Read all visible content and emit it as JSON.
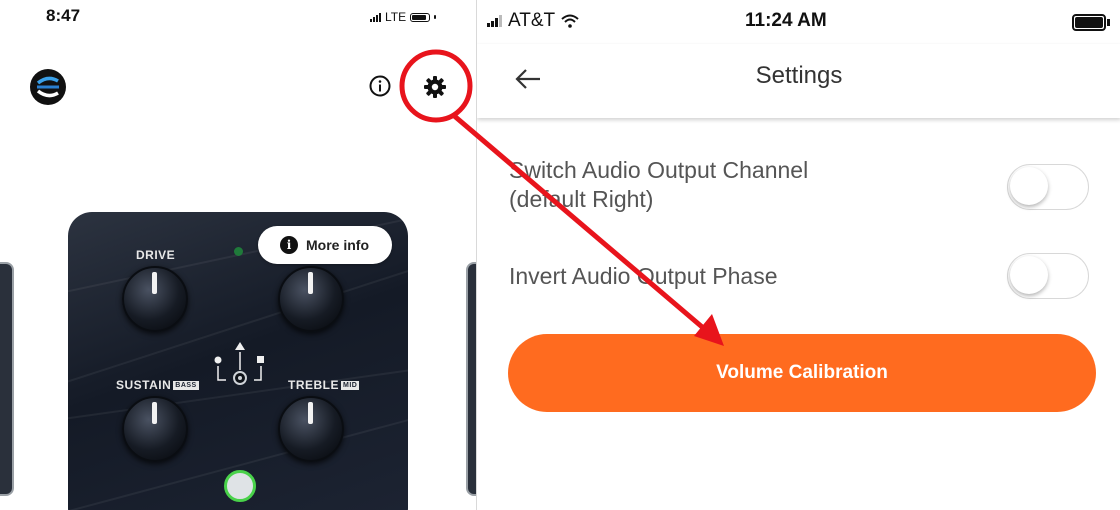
{
  "left_phone": {
    "status": {
      "time": "8:47",
      "network": "LTE"
    },
    "header": {
      "logo_icon": "source-audio-logo-icon",
      "info_icon": "info-circle-icon",
      "settings_icon": "gear-icon"
    },
    "pedal": {
      "knobs": [
        {
          "label": "DRIVE",
          "tag": ""
        },
        {
          "label": "",
          "tag": ""
        },
        {
          "label": "SUSTAIN",
          "tag": "BASS"
        },
        {
          "label": "TREBLE",
          "tag": "MID"
        }
      ]
    },
    "more_info": {
      "label": "More info"
    }
  },
  "right_phone": {
    "status": {
      "carrier": "AT&T",
      "time": "11:24 AM"
    },
    "header": {
      "title": "Settings",
      "back_icon": "arrow-left-icon"
    },
    "settings": [
      {
        "label_line1": "Switch Audio Output Channel",
        "label_line2": "(default Right)",
        "enabled": false
      },
      {
        "label_line1": "Invert Audio Output Phase",
        "enabled": false
      }
    ],
    "volume_button": {
      "label": "Volume Calibration"
    }
  },
  "annotation": {
    "circle_color": "#e8141c",
    "arrow_color": "#e8141c",
    "accent": "#ff6b1f"
  }
}
